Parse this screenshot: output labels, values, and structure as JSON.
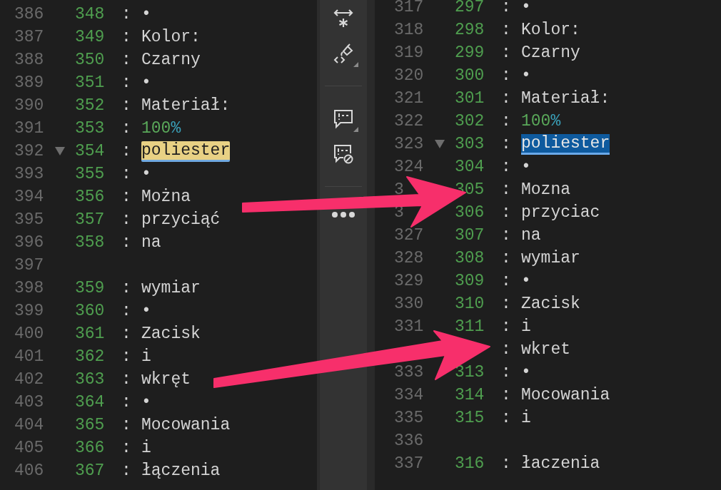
{
  "panes": [
    {
      "rows": [
        {
          "line": "386",
          "ref": "348",
          "sep": ":",
          "text": "•",
          "fold": false
        },
        {
          "line": "387",
          "ref": "349",
          "sep": ":",
          "text": "Kolor:",
          "fold": false
        },
        {
          "line": "388",
          "ref": "350",
          "sep": ":",
          "text": "Czarny",
          "fold": false
        },
        {
          "line": "389",
          "ref": "351",
          "sep": ":",
          "text": "•",
          "fold": false
        },
        {
          "line": "390",
          "ref": "352",
          "sep": ":",
          "text": "Materiał:",
          "fold": false
        },
        {
          "line": "391",
          "ref": "353",
          "sep": ":",
          "tokens": [
            {
              "text": "100",
              "kind": "number"
            },
            {
              "text": "%",
              "kind": "unit"
            }
          ],
          "fold": false
        },
        {
          "line": "392",
          "ref": "354",
          "sep": ":",
          "text": "poliester",
          "fold": true,
          "kind": "match"
        },
        {
          "line": "393",
          "ref": "355",
          "sep": ":",
          "text": "•",
          "fold": false
        },
        {
          "line": "394",
          "ref": "356",
          "sep": ":",
          "text": "Można",
          "fold": false
        },
        {
          "line": "395",
          "ref": "357",
          "sep": ":",
          "text": "przyciąć",
          "fold": false
        },
        {
          "line": "396",
          "ref": "358",
          "sep": ":",
          "text": "na",
          "fold": false
        },
        {
          "line": "397",
          "fold": false
        },
        {
          "line": "398",
          "ref": "359",
          "sep": ":",
          "text": "wymiar",
          "fold": false
        },
        {
          "line": "399",
          "ref": "360",
          "sep": ":",
          "text": "•",
          "fold": false
        },
        {
          "line": "400",
          "ref": "361",
          "sep": ":",
          "text": "Zacisk",
          "fold": false
        },
        {
          "line": "401",
          "ref": "362",
          "sep": ":",
          "text": "i",
          "fold": false
        },
        {
          "line": "402",
          "ref": "363",
          "sep": ":",
          "text": "wkręt",
          "fold": false
        },
        {
          "line": "403",
          "ref": "364",
          "sep": ":",
          "text": "•",
          "fold": false
        },
        {
          "line": "404",
          "ref": "365",
          "sep": ":",
          "text": "Mocowania",
          "fold": false
        },
        {
          "line": "405",
          "ref": "366",
          "sep": ":",
          "text": "i",
          "fold": false
        },
        {
          "line": "406",
          "ref": "367",
          "sep": ":",
          "text": "łączenia",
          "fold": false
        }
      ]
    },
    {
      "rows": [
        {
          "line": "317",
          "ref": "297",
          "sep": ":",
          "text": "•",
          "fold": false
        },
        {
          "line": "318",
          "ref": "298",
          "sep": ":",
          "text": "Kolor:",
          "fold": false
        },
        {
          "line": "319",
          "ref": "299",
          "sep": ":",
          "text": "Czarny",
          "fold": false
        },
        {
          "line": "320",
          "ref": "300",
          "sep": ":",
          "text": "•",
          "fold": false
        },
        {
          "line": "321",
          "ref": "301",
          "sep": ":",
          "text": "Materiał:",
          "fold": false
        },
        {
          "line": "322",
          "ref": "302",
          "sep": ":",
          "tokens": [
            {
              "text": "100",
              "kind": "number"
            },
            {
              "text": "%",
              "kind": "unit"
            }
          ],
          "fold": false
        },
        {
          "line": "323",
          "ref": "303",
          "sep": ":",
          "text": "poliester",
          "fold": true,
          "kind": "selection"
        },
        {
          "line": "324",
          "ref": "304",
          "sep": ":",
          "text": "•",
          "fold": false
        },
        {
          "line": "3",
          "ref": "305",
          "sep": ":",
          "text": "Mozna",
          "fold": false
        },
        {
          "line": "3",
          "ref": "306",
          "sep": ":",
          "text": "przyciac",
          "fold": false
        },
        {
          "line": "327",
          "ref": "307",
          "sep": ":",
          "text": "na",
          "fold": false
        },
        {
          "line": "328",
          "ref": "308",
          "sep": ":",
          "text": "wymiar",
          "fold": false
        },
        {
          "line": "329",
          "ref": "309",
          "sep": ":",
          "text": "•",
          "fold": false
        },
        {
          "line": "330",
          "ref": "310",
          "sep": ":",
          "text": "Zacisk",
          "fold": false
        },
        {
          "line": "331",
          "ref": "311",
          "sep": ":",
          "text": "i",
          "fold": false
        },
        {
          "sep": ":",
          "text": "wkret",
          "fold": false
        },
        {
          "line": "333",
          "ref": "313",
          "sep": ":",
          "text": "•",
          "fold": false
        },
        {
          "line": "334",
          "ref": "314",
          "sep": ":",
          "text": "Mocowania",
          "fold": false
        },
        {
          "line": "335",
          "ref": "315",
          "sep": ":",
          "text": "i",
          "fold": false
        },
        {
          "line": "336",
          "fold": false
        },
        {
          "line": "337",
          "ref": "316",
          "sep": ":",
          "text": "łaczenia",
          "fold": false
        }
      ]
    }
  ],
  "toolbar": [
    {
      "kind": "button",
      "menu": false
    },
    {
      "kind": "button",
      "menu": true
    },
    {
      "kind": "separator"
    },
    {
      "kind": "button",
      "menu": true
    },
    {
      "kind": "button",
      "menu": false
    },
    {
      "kind": "separator"
    },
    {
      "kind": "overflow",
      "menu": false
    }
  ]
}
